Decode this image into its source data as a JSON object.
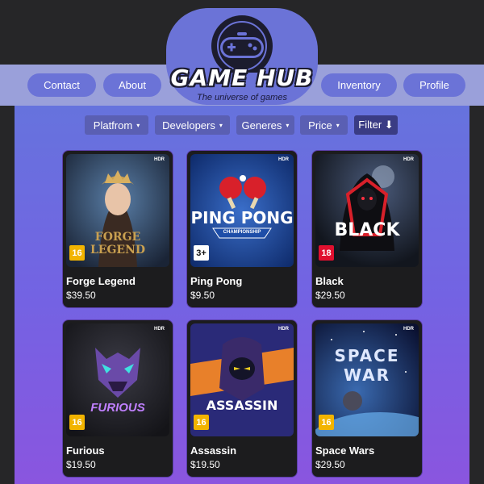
{
  "brand": {
    "title": "GAME HUB",
    "tagline": "The universe of games"
  },
  "nav": {
    "contact": "Contact",
    "about": "About",
    "inventory": "Inventory",
    "profile": "Profile"
  },
  "filters": {
    "platform": "Platfrom",
    "developers": "Developers",
    "genres": "Generes",
    "price": "Price",
    "filter": "Filter ⬇",
    "caret": "▾"
  },
  "games": [
    {
      "title": "Forge Legend",
      "price": "$39.50",
      "rating": "16",
      "art_text": "FORGE LEGEND",
      "rating_color": "#f2b400"
    },
    {
      "title": "Ping Pong",
      "price": "$9.50",
      "rating": "3+",
      "art_text": "PING PONG",
      "art_sub": "CHAMPIONSHIP",
      "rating_color": "#ffffff"
    },
    {
      "title": "Black",
      "price": "$29.50",
      "rating": "18",
      "art_text": "BLACK",
      "rating_color": "#e0102f"
    },
    {
      "title": "Furious",
      "price": "$19.50",
      "rating": "16",
      "art_text": "FURIOUS",
      "rating_color": "#f2b400"
    },
    {
      "title": "Assassin",
      "price": "$19.50",
      "rating": "16",
      "art_text": "ASSASSIN",
      "rating_color": "#f2b400"
    },
    {
      "title": "Space Wars",
      "price": "$29.50",
      "rating": "16",
      "art_text": "SPACE WAR",
      "rating_color": "#f2b400"
    }
  ],
  "badge": {
    "hdr": "HDR"
  },
  "colors": {
    "nav_bg": "#9aa0da",
    "button": "#6b73d7",
    "filter_button": "#5a5fb3",
    "card_bg": "#1c1c1e"
  }
}
